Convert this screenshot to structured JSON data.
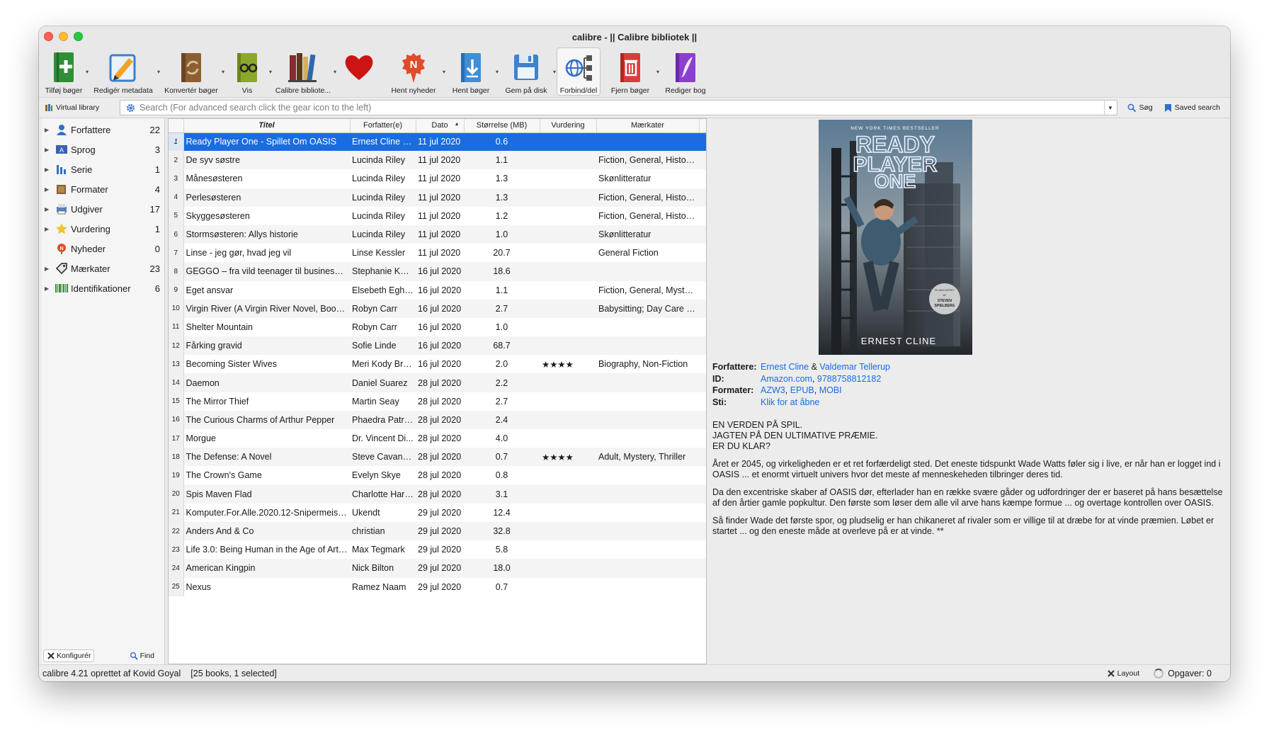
{
  "window": {
    "title": "calibre - || Calibre bibliotek ||"
  },
  "toolbar": [
    {
      "label": "Tilføj bøger",
      "icon": "add-book-icon",
      "arrow": true
    },
    {
      "label": "Redigér metadata",
      "icon": "edit-metadata-icon",
      "arrow": true
    },
    {
      "label": "Konvertér bøger",
      "icon": "convert-books-icon",
      "arrow": true
    },
    {
      "label": "Vis",
      "icon": "view-book-icon",
      "arrow": true
    },
    {
      "label": "Calibre bibliote...",
      "icon": "library-books-icon",
      "arrow": true
    },
    {
      "label": "",
      "icon": "heart-icon",
      "arrow": false
    },
    {
      "label": "Hent nyheder",
      "icon": "fetch-news-icon",
      "arrow": true
    },
    {
      "label": "Hent bøger",
      "icon": "get-books-icon",
      "arrow": true
    },
    {
      "label": "Gem på disk",
      "icon": "save-disk-icon",
      "arrow": true
    },
    {
      "label": "Forbind/del",
      "icon": "connect-share-icon",
      "arrow": false,
      "active": true
    },
    {
      "label": "Fjern bøger",
      "icon": "remove-books-icon",
      "arrow": true
    },
    {
      "label": "Rediger bog",
      "icon": "edit-book-icon",
      "arrow": false
    }
  ],
  "search": {
    "virtual_library": "Virtual library",
    "placeholder": "Search (For advanced search click the gear icon to the left)",
    "search_button": "Søg",
    "saved_search": "Saved search"
  },
  "sidebar": {
    "items": [
      {
        "label": "Forfattere",
        "count": "22",
        "icon": "authors-icon",
        "expandable": true
      },
      {
        "label": "Sprog",
        "count": "3",
        "icon": "language-icon",
        "expandable": true
      },
      {
        "label": "Serie",
        "count": "1",
        "icon": "series-icon",
        "expandable": true
      },
      {
        "label": "Formater",
        "count": "4",
        "icon": "formats-icon",
        "expandable": true
      },
      {
        "label": "Udgiver",
        "count": "17",
        "icon": "publisher-icon",
        "expandable": true
      },
      {
        "label": "Vurdering",
        "count": "1",
        "icon": "star-icon",
        "expandable": true
      },
      {
        "label": "Nyheder",
        "count": "0",
        "icon": "news-icon",
        "expandable": false
      },
      {
        "label": "Mærkater",
        "count": "23",
        "icon": "tags-icon",
        "expandable": true
      },
      {
        "label": "Identifikationer",
        "count": "6",
        "icon": "barcode-icon",
        "expandable": true
      }
    ],
    "configure": "Konfigurér",
    "find": "Find"
  },
  "table": {
    "columns": [
      "Titel",
      "Forfatter(e)",
      "Dato",
      "Størrelse (MB)",
      "Vurdering",
      "Mærkater"
    ],
    "rows": [
      {
        "num": "1",
        "title": "Ready Player One - Spillet Om OASIS",
        "author": "Ernest Cline &...",
        "date": "11 jul 2020",
        "size": "0.6",
        "rating": "",
        "tags": ""
      },
      {
        "num": "2",
        "title": "De syv søstre",
        "author": "Lucinda Riley",
        "date": "11 jul 2020",
        "size": "1.1",
        "rating": "",
        "tags": "Fiction, General, Historic..."
      },
      {
        "num": "3",
        "title": "Månesøsteren",
        "author": "Lucinda Riley",
        "date": "11 jul 2020",
        "size": "1.3",
        "rating": "",
        "tags": "Skønlitteratur"
      },
      {
        "num": "4",
        "title": "Perlesøsteren",
        "author": "Lucinda Riley",
        "date": "11 jul 2020",
        "size": "1.3",
        "rating": "",
        "tags": "Fiction, General, Historic..."
      },
      {
        "num": "5",
        "title": "Skyggesøsteren",
        "author": "Lucinda Riley",
        "date": "11 jul 2020",
        "size": "1.2",
        "rating": "",
        "tags": "Fiction, General, Historic..."
      },
      {
        "num": "6",
        "title": "Stormsøsteren: Allys historie",
        "author": "Lucinda Riley",
        "date": "11 jul 2020",
        "size": "1.0",
        "rating": "",
        "tags": "Skønlitteratur"
      },
      {
        "num": "7",
        "title": "Linse - jeg gør, hvad jeg vil",
        "author": "Linse Kessler",
        "date": "11 jul 2020",
        "size": "20.7",
        "rating": "",
        "tags": "General Fiction"
      },
      {
        "num": "8",
        "title": "GEGGO – fra vild teenager til businesskvi...",
        "author": "Stephanie Kar...",
        "date": "16 jul 2020",
        "size": "18.6",
        "rating": "",
        "tags": ""
      },
      {
        "num": "9",
        "title": "Eget ansvar",
        "author": "Elsebeth Egho...",
        "date": "16 jul 2020",
        "size": "1.1",
        "rating": "",
        "tags": "Fiction, General, Mystery..."
      },
      {
        "num": "10",
        "title": "Virgin River (A Virgin River Novel, Book 1)",
        "author": "Robyn Carr",
        "date": "16 jul 2020",
        "size": "2.7",
        "rating": "",
        "tags": "Babysitting; Day Care & ..."
      },
      {
        "num": "11",
        "title": "Shelter Mountain",
        "author": "Robyn Carr",
        "date": "16 jul 2020",
        "size": "1.0",
        "rating": "",
        "tags": ""
      },
      {
        "num": "12",
        "title": "Fårking gravid",
        "author": "Sofie Linde",
        "date": "16 jul 2020",
        "size": "68.7",
        "rating": "",
        "tags": ""
      },
      {
        "num": "13",
        "title": "Becoming Sister Wives",
        "author": "Meri Kody Bro...",
        "date": "16 jul 2020",
        "size": "2.0",
        "rating": "★★★★",
        "tags": "Biography, Non-Fiction"
      },
      {
        "num": "14",
        "title": "Daemon",
        "author": "Daniel Suarez",
        "date": "28 jul 2020",
        "size": "2.2",
        "rating": "",
        "tags": ""
      },
      {
        "num": "15",
        "title": "The Mirror Thief",
        "author": "Martin Seay",
        "date": "28 jul 2020",
        "size": "2.7",
        "rating": "",
        "tags": ""
      },
      {
        "num": "16",
        "title": "The Curious Charms of Arthur Pepper",
        "author": "Phaedra Patrick",
        "date": "28 jul 2020",
        "size": "2.4",
        "rating": "",
        "tags": ""
      },
      {
        "num": "17",
        "title": "Morgue",
        "author": "Dr. Vincent Di...",
        "date": "28 jul 2020",
        "size": "4.0",
        "rating": "",
        "tags": ""
      },
      {
        "num": "18",
        "title": "The Defense: A Novel",
        "author": "Steve Cavanagh",
        "date": "28 jul 2020",
        "size": "0.7",
        "rating": "★★★★",
        "tags": "Adult, Mystery, Thriller"
      },
      {
        "num": "19",
        "title": "The Crown's Game",
        "author": "Evelyn Skye",
        "date": "28 jul 2020",
        "size": "0.8",
        "rating": "",
        "tags": ""
      },
      {
        "num": "20",
        "title": "Spis Maven Flad",
        "author": "Charlotte Hart...",
        "date": "28 jul 2020",
        "size": "3.1",
        "rating": "",
        "tags": ""
      },
      {
        "num": "21",
        "title": "Komputer.For.Alle.2020.12-Snipermeister",
        "author": "Ukendt",
        "date": "29 jul 2020",
        "size": "12.4",
        "rating": "",
        "tags": ""
      },
      {
        "num": "22",
        "title": "Anders And & Co",
        "author": "christian",
        "date": "29 jul 2020",
        "size": "32.8",
        "rating": "",
        "tags": ""
      },
      {
        "num": "23",
        "title": "Life 3.0: Being Human in the Age of Artifi...",
        "author": "Max Tegmark",
        "date": "29 jul 2020",
        "size": "5.8",
        "rating": "",
        "tags": ""
      },
      {
        "num": "24",
        "title": "American Kingpin",
        "author": "Nick Bilton",
        "date": "29 jul 2020",
        "size": "18.0",
        "rating": "",
        "tags": ""
      },
      {
        "num": "25",
        "title": "Nexus",
        "author": "Ramez Naam",
        "date": "29 jul 2020",
        "size": "0.7",
        "rating": "",
        "tags": ""
      }
    ]
  },
  "details": {
    "cover": {
      "top_line": "NEW YORK TIMES BESTSELLER",
      "title_line1": "READY",
      "title_line2": "PLAYER",
      "title_line3": "ONE",
      "author": "ERNEST CLINE",
      "badge_line1": "FILMATISERET",
      "badge_line2": "AF",
      "badge_line3": "STEVEN",
      "badge_line4": "SPIELBERG"
    },
    "authors_label": "Forfattere:",
    "author1": "Ernest Cline",
    "amp": "&",
    "author2": "Valdemar Tellerup",
    "id_label": "ID:",
    "id1": "Amazon.com",
    "id2": "9788758812182",
    "formats_label": "Formater:",
    "format1": "AZW3",
    "format2": "EPUB",
    "format3": "MOBI",
    "path_label": "Sti:",
    "path_link": "Klik for at åbne",
    "comment_lines": [
      "EN VERDEN PÅ SPIL.",
      "JAGTEN PÅ DEN ULTIMATIVE PRÆMIE.",
      "ER DU KLAR?"
    ],
    "paragraphs": [
      "Året er 2045, og virkeligheden er et ret forfærdeligt sted. Det eneste tidspunkt Wade Watts føler sig i live, er når han er logget ind i OASIS ... et enormt virtuelt univers hvor det meste af menneskeheden tilbringer deres tid.",
      "Da den excentriske skaber af OASIS dør, efterlader han en række svære gåder og udfordringer der er baseret på hans besættelse af den årtier gamle popkultur. Den første som løser dem alle vil arve hans kæmpe formue ... og overtage kontrollen over OASIS.",
      "Så finder Wade det første spor, og pludselig er han chikaneret af rivaler som er villige til at dræbe for at vinde præmien. Løbet er startet ... og den eneste måde at overleve på er at vinde. **"
    ]
  },
  "status": {
    "left": "calibre 4.21 oprettet af Kovid Goyal",
    "count": "[25 books, 1 selected]",
    "layout": "Layout",
    "jobs": "Opgaver: 0"
  }
}
